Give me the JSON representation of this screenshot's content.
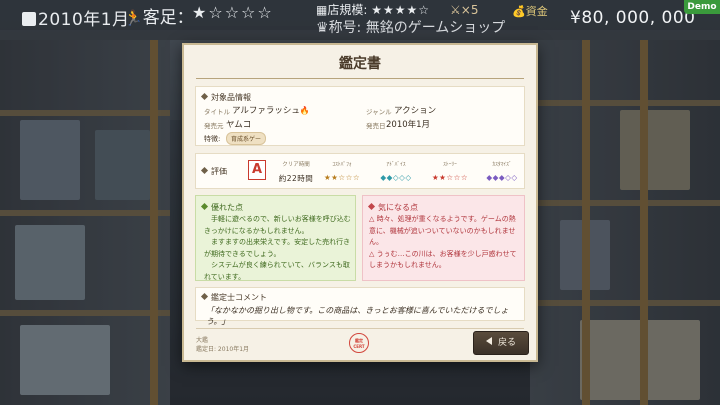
{
  "hud": {
    "date": "2010年1月",
    "visitors_label": "客足：",
    "visitor_stars": "★☆☆☆☆",
    "shop_scale_label": "店規模:",
    "shop_scale_stars": "★★★★☆",
    "title_line": "称号: 無銘のゲームショップ",
    "staff_count": "×5",
    "funds_label": "資金",
    "funds": "¥80, 000, 000",
    "demo_badge": "Demo"
  },
  "dialog": {
    "title": "鑑定書",
    "product": {
      "section_label": "対象品情報",
      "title_label": "タイトル",
      "title_value": "アルファラッシュ",
      "genre_label": "ジャンル",
      "genre_value": "アクション",
      "publisher_label": "発売元",
      "publisher_value": "ヤムコ",
      "release_label": "発売日",
      "release_value": "2010年1月",
      "features_label": "特徴:",
      "feature_tag": "育成系ゲー"
    },
    "rating": {
      "section_label": "評価",
      "grade": "A",
      "metrics": [
        {
          "label": "クリア時間",
          "value": "約22時間"
        },
        {
          "label": "ｺｽﾄﾊﾟﾌｫ",
          "value": "★★☆☆☆"
        },
        {
          "label": "ｱﾄﾞﾊﾞｲｽ",
          "value": "◆◆◇◇◇"
        },
        {
          "label": "ｽﾄｰﾘｰ",
          "value": "★★☆☆☆"
        },
        {
          "label": "ｶｽﾀﾏｲｽﾞ",
          "value": "◆◆◆◇◇"
        }
      ]
    },
    "good_points": {
      "heading": "優れた点",
      "lines": [
        "　手軽に遊べるので、新しいお客様を呼び込む",
        "きっかけになるかもしれません。",
        "　ますますの出来栄えです。安定した売れ行き",
        "が期待できるでしょう。",
        "　システムが良く練られていて、バランスも取",
        "れています。"
      ]
    },
    "bad_points": {
      "heading": "気になる点",
      "lines": [
        "△ 時々、処理が重くなるようです。ゲームの熱",
        "意に、機械が追いついていないのかもしれませ",
        "ん。",
        "△ うぅむ…この川は、お客様を少し戸惑わせて",
        "しまうかもしれません。"
      ]
    },
    "comment": {
      "heading": "鑑定士コメント",
      "text": "「なかなかの掘り出し物です。この商品は、きっとお客様に喜んでいただけるでしょう。」"
    },
    "footer": {
      "line1": "大鑑",
      "line2": "鑑定日: 2010年1月",
      "seal_line1": "鑑定",
      "seal_line2": "CERT"
    },
    "back_button": "戻る"
  }
}
